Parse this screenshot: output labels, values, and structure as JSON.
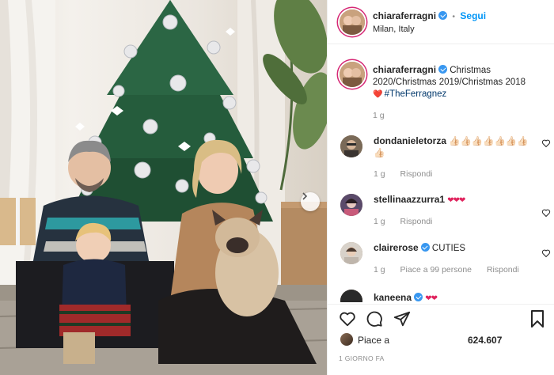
{
  "post": {
    "author": "chiaraferragni",
    "follow_label": "Segui",
    "location": "Milan, Italy",
    "follow_separator": "•"
  },
  "caption": {
    "author": "chiaraferragni",
    "text": "Christmas 2020/Christmas 2019/Christmas 2018",
    "hashtag": "#TheFerragnez",
    "time": "1 g"
  },
  "comments": [
    {
      "user": "dondanieletorza",
      "text": "👍🏻👍🏻👍🏻👍🏻👍🏻👍🏻👍🏻👍🏻",
      "time": "1 g",
      "reply": "Rispondi",
      "likes": ""
    },
    {
      "user": "stellinaazzurra1",
      "text": "❤❤❤",
      "time": "1 g",
      "reply": "Rispondi",
      "likes": ""
    },
    {
      "user": "clairerose",
      "text": "CUTIES",
      "time": "1 g",
      "reply": "Rispondi",
      "likes": "Piace a 99 persone",
      "verified": true
    },
    {
      "user": "kaneena",
      "text": "❤❤",
      "verified": true
    }
  ],
  "likes": {
    "label": "Piace a",
    "count": "624.607"
  },
  "timestamp": "1 GIORNO FA",
  "icons": {
    "like": "heart-icon",
    "comment": "comment-icon",
    "share": "send-icon",
    "save": "bookmark-icon",
    "next": "chevron-right-icon"
  },
  "colors": {
    "accent": "#0095f6",
    "verified": "#3897f0",
    "story_ring": "#d62976"
  }
}
